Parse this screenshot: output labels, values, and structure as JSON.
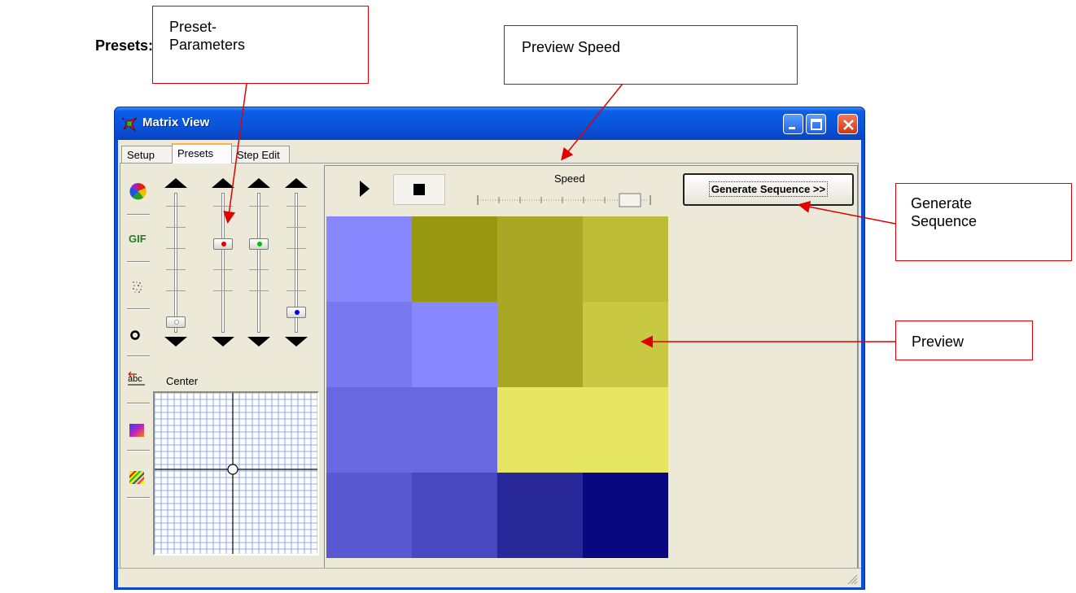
{
  "heading": "Presets:",
  "callouts": {
    "preset_params_line1": "Preset-",
    "preset_params_line2": "Parameters",
    "preview_speed": "Preview Speed",
    "generate_line1": "Generate",
    "generate_line2": "Sequence",
    "preview": "Preview"
  },
  "window": {
    "title": "Matrix View",
    "tabs": [
      "Setup",
      "Presets",
      "Step Edit"
    ],
    "active_tab": "Presets"
  },
  "presets_panel": {
    "center_label": "Center",
    "icon_buttons": [
      "color-wheel-icon",
      "gif-icon",
      "noise-icon",
      "ring-icon",
      "text-scroll-icon",
      "gradient-icon",
      "stripes-icon"
    ],
    "gif_icon_text": "GIF",
    "text_icon_text": "abc",
    "slider_dot_colors": [
      "#ffffff",
      "#e00000",
      "#00c000",
      "#0000e0"
    ]
  },
  "preview_panel": {
    "speed_label": "Speed",
    "generate_button": "Generate Sequence >>",
    "grid_colors": [
      [
        "#8888fe",
        "#989810",
        "#a8a824",
        "#bcbc36"
      ],
      [
        "#7878f0",
        "#8888fe",
        "#a8a824",
        "#c8c842"
      ],
      [
        "#6868e0",
        "#6868e0",
        "#e6e662",
        "#e6e662"
      ],
      [
        "#5858d0",
        "#4848c0",
        "#282898",
        "#080880"
      ]
    ]
  },
  "colors": {
    "titlebar": "#0a55dc",
    "callout_border": "#e00000",
    "window_bg": "#ece9d8"
  }
}
